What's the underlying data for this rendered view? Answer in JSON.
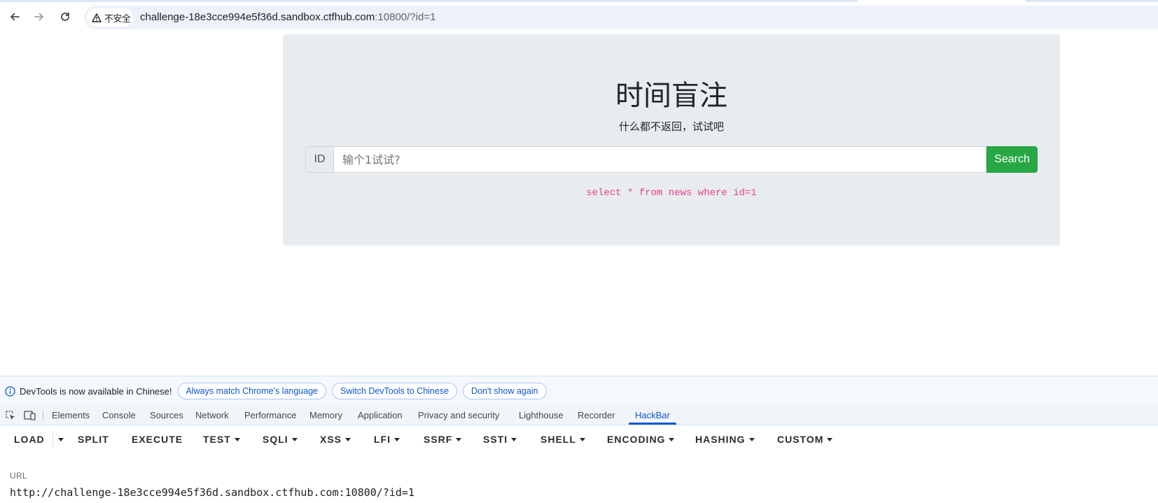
{
  "browser": {
    "security_label": "不安全",
    "url_host": "challenge-18e3cce994e5f36d.sandbox.ctfhub.com",
    "url_rest": ":10800/?id=1",
    "icons": {
      "back": "back-arrow-icon",
      "forward": "forward-arrow-icon",
      "reload": "reload-icon",
      "warning": "warning-triangle-icon"
    }
  },
  "page": {
    "title": "时间盲注",
    "subtitle": "什么都不返回，试试吧",
    "input_prefix": "ID",
    "input_placeholder": "输个1试试?",
    "search_button": "Search",
    "sql_query": "select * from news where id=1",
    "colors": {
      "jumbotron_bg": "#e9ecef",
      "search_button_bg": "#28a745",
      "sql_text": "#e83e8c"
    }
  },
  "devtools": {
    "notice": {
      "text": "DevTools is now available in Chinese!",
      "buttons": [
        "Always match Chrome's language",
        "Switch DevTools to Chinese",
        "Don't show again"
      ]
    },
    "tabs": [
      "Elements",
      "Console",
      "Sources",
      "Network",
      "Performance",
      "Memory",
      "Application",
      "Privacy and security",
      "Lighthouse",
      "Recorder",
      "HackBar"
    ],
    "active_tab": "HackBar",
    "hackbar": {
      "load": "LOAD",
      "split": "SPLIT",
      "execute": "EXECUTE",
      "menus": [
        "TEST",
        "SQLI",
        "XSS",
        "LFI",
        "SSRF",
        "SSTI",
        "SHELL",
        "ENCODING",
        "HASHING",
        "CUSTOM"
      ],
      "url_label": "URL",
      "url_value": "http://challenge-18e3cce994e5f36d.sandbox.ctfhub.com:10800/?id=1"
    }
  }
}
